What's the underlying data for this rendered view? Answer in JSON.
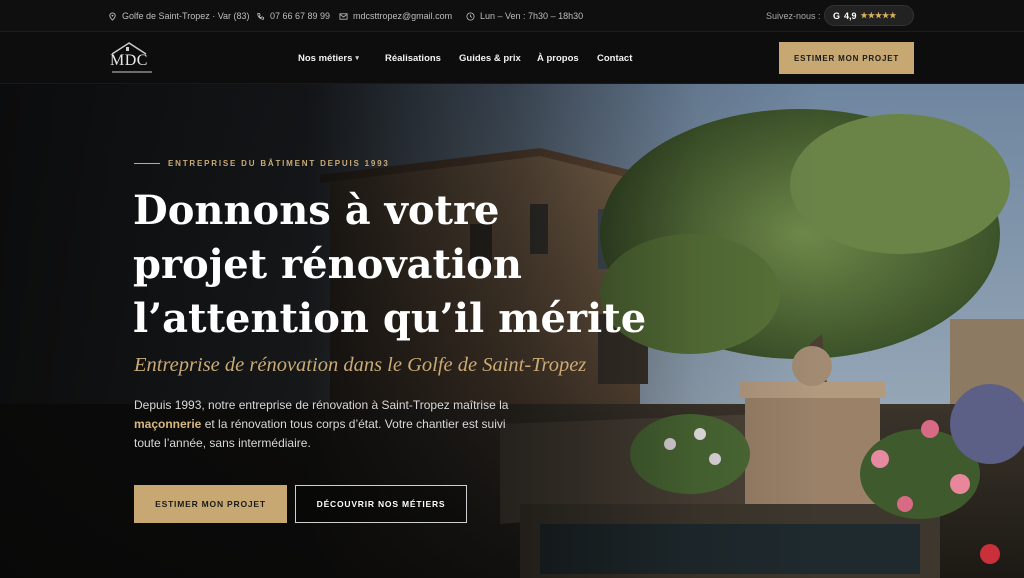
{
  "topbar": {
    "location": "Golfe de Saint-Tropez · Var (83)",
    "phone": "07 66 67 89 99",
    "email": "mdcsttropez@gmail.com",
    "hours": "Lun – Ven : 7h30 – 18h30",
    "follow_label": "Suivez-nous :",
    "rating_badge": "G",
    "rating_value": "4,9",
    "stars": "★★★★★"
  },
  "nav": {
    "logo_text": "MDC",
    "items": [
      {
        "label": "Nos métiers",
        "has_dropdown": true
      },
      {
        "label": "Réalisations"
      },
      {
        "label": "Guides & prix"
      },
      {
        "label": "À propos"
      },
      {
        "label": "Contact"
      }
    ],
    "cta_label": "ESTIMER MON PROJET"
  },
  "hero": {
    "eyebrow": "ENTREPRISE DU BÂTIMENT DEPUIS 1993",
    "title_lines": [
      "Donnons à votre",
      "projet rénovation",
      "l’attention qu’il mérite"
    ],
    "subtitle": "Entreprise de rénovation dans le Golfe de Saint-Tropez",
    "desc_before": "Depuis 1993, notre entreprise de rénovation à Saint-Tropez maîtrise la ",
    "desc_highlight": "maçonnerie",
    "desc_after": " et la rénovation tous corps d’état. Votre chantier est suivi toute l’année, sans intermédiaire.",
    "primary_button": "ESTIMER MON PROJET",
    "secondary_button": "DÉCOUVRIR NOS MÉTIERS"
  },
  "colors": {
    "accent_gold": "#c7a873",
    "background": "#0b0b0b",
    "stars": "#d8b25a"
  }
}
